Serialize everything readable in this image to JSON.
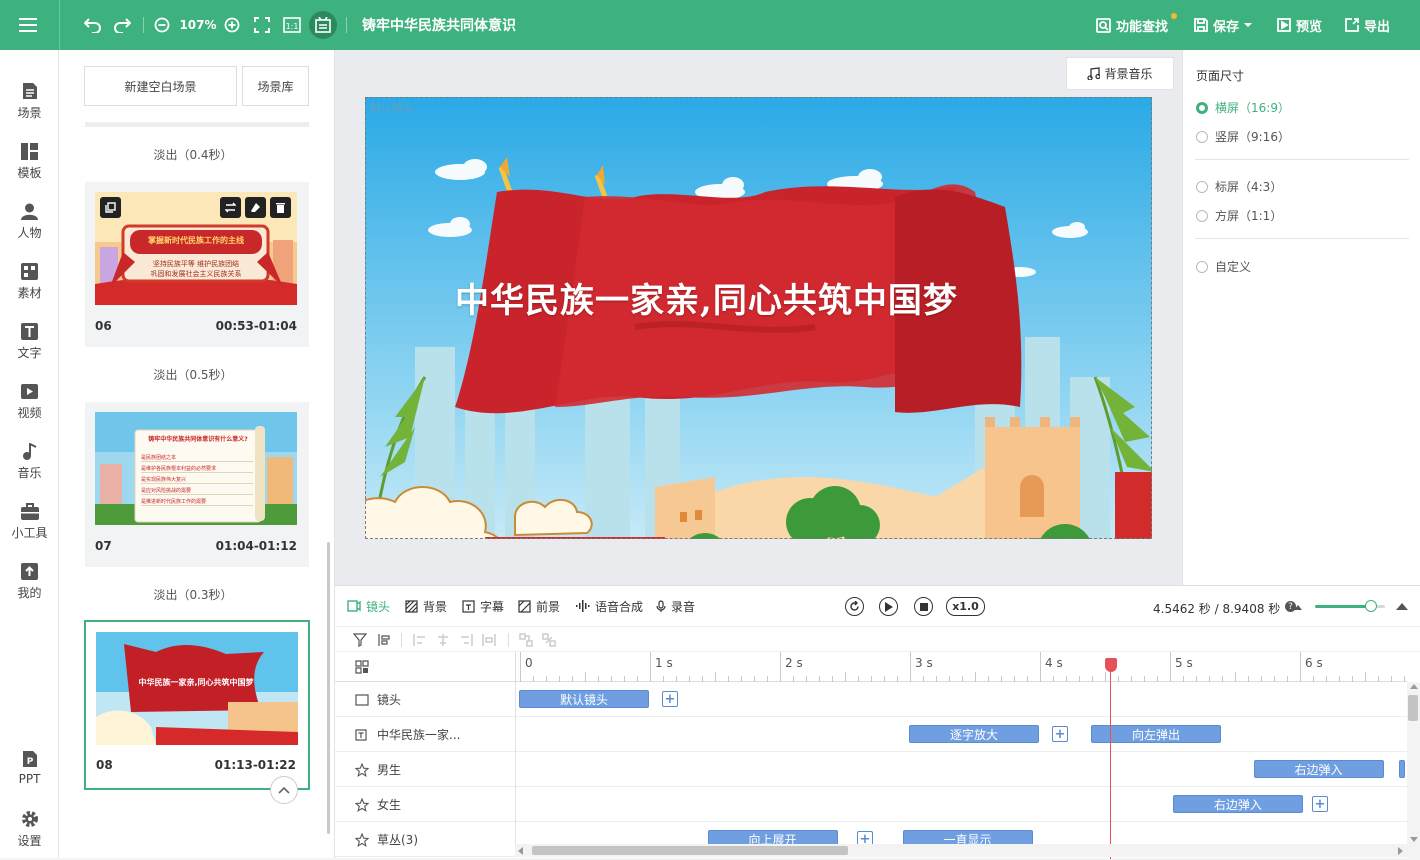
{
  "topbar": {
    "zoom": "107%",
    "title": "铸牢中华民族共同体意识",
    "find_label": "功能查找",
    "save_label": "保存",
    "preview_label": "预览",
    "export_label": "导出"
  },
  "nav": {
    "items": [
      "场景",
      "模板",
      "人物",
      "素材",
      "文字",
      "视频",
      "音乐",
      "小工具",
      "我的"
    ],
    "bottom": [
      "PPT",
      "设置"
    ]
  },
  "scenes": {
    "new_blank_label": "新建空白场景",
    "library_label": "场景库",
    "transitions": [
      "淡出（0.4秒）",
      "淡出（0.5秒）",
      "淡出（0.3秒）"
    ],
    "cards": [
      {
        "num": "06",
        "time": "00:53-01:04",
        "thumb_title": "掌握新时代民族工作的主线",
        "thumb_lines": [
          "坚持民族平等 维护民族团结",
          "巩固和发展社会主义民族关系"
        ]
      },
      {
        "num": "07",
        "time": "01:04-01:12",
        "thumb_title": "铸牢中华民族共同体意识有什么意义?",
        "thumb_lines": [
          "是民族团结之本",
          "是维护各民族根本利益的必然要求",
          "是实现民族伟大复兴",
          "是应对风险挑战的需要",
          "是推进新时代民族工作的需要"
        ]
      },
      {
        "num": "08",
        "time": "01:13-01:22",
        "thumb_title": "中华民族一家亲,同心共筑中国梦"
      }
    ]
  },
  "canvas": {
    "bg_music_label": "背景音乐",
    "lens_label": "默认镜头",
    "headline": "中华民族一家亲,同心共筑中国梦"
  },
  "page_size": {
    "heading": "页面尺寸",
    "options": [
      "横屏（16:9）",
      "竖屏（9:16）",
      "标屏（4:3）",
      "方屏（1:1）",
      "自定义"
    ],
    "selected": 0
  },
  "timeline": {
    "tabs": [
      "镜头",
      "背景",
      "字幕",
      "前景",
      "语音合成",
      "录音"
    ],
    "speed": "x1.0",
    "time_readout": "4.5462 秒 / 8.9408 秒",
    "ruler": [
      "0",
      "1 s",
      "2 s",
      "3 s",
      "4 s",
      "5 s",
      "6 s"
    ],
    "zoom_slider": 0.8,
    "playhead_seconds": 4.55,
    "tracks": [
      {
        "label": "镜头",
        "icon": "camera-frame-icon",
        "clips": [
          {
            "label": "默认镜头",
            "start": 0,
            "end": 1.0
          }
        ],
        "plus_at": 1.1
      },
      {
        "label": "中华民族一家...",
        "icon": "text-box-icon",
        "clips": [
          {
            "label": "逐字放大",
            "start": 3.0,
            "end": 4.0
          },
          {
            "label": "向左弹出",
            "start": 4.4,
            "end": 5.4
          }
        ],
        "plus_at": 4.1
      },
      {
        "label": "男生",
        "icon": "star-figure-icon",
        "clips": [
          {
            "label": "右边弹入",
            "start": 5.65,
            "end": 6.65
          }
        ],
        "plus_at": null
      },
      {
        "label": "女生",
        "icon": "star-figure-icon",
        "clips": [
          {
            "label": "右边弹入",
            "start": 5.03,
            "end": 6.03
          }
        ],
        "plus_at": 6.1
      },
      {
        "label": "草丛(3)",
        "icon": "star-figure-icon",
        "clips": [
          {
            "label": "向上展开",
            "start": 1.45,
            "end": 2.45
          },
          {
            "label": "一直显示",
            "start": 2.95,
            "end": 3.95
          }
        ],
        "plus_at": 2.6
      }
    ]
  }
}
